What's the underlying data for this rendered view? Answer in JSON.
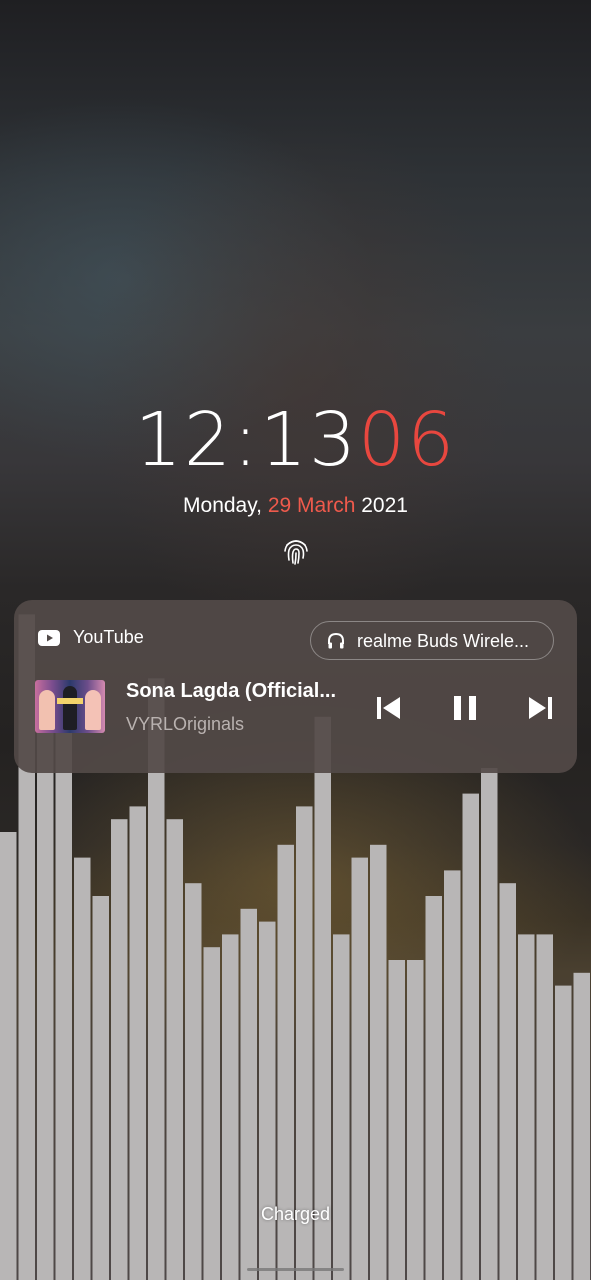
{
  "lockscreen": {
    "clock": {
      "hours_minutes": "12:13",
      "seconds": "06"
    },
    "date": {
      "weekday": "Monday, ",
      "day_month": "29 March",
      "year": " 2021"
    },
    "fingerprint_icon": "fingerprint-icon"
  },
  "media_card": {
    "app_name": "YouTube",
    "app_icon": "youtube-icon",
    "output_device": "realme Buds Wirele...",
    "output_icon": "headphones-icon",
    "track_title": "Sona Lagda (Official...",
    "artist": "VYRLOriginals",
    "controls": {
      "prev_icon": "skip-previous-icon",
      "pause_icon": "pause-icon",
      "next_icon": "skip-next-icon"
    }
  },
  "visualizer": {
    "bar_color": "#b8b6b6",
    "levels": [
      0.35,
      0.52,
      0.44,
      0.44,
      0.33,
      0.3,
      0.36,
      0.37,
      0.47,
      0.36,
      0.31,
      0.26,
      0.27,
      0.29,
      0.28,
      0.34,
      0.37,
      0.44,
      0.27,
      0.33,
      0.34,
      0.25,
      0.25,
      0.3,
      0.32,
      0.38,
      0.4,
      0.31,
      0.27,
      0.27,
      0.23,
      0.24
    ]
  },
  "status": {
    "battery_text": "Charged"
  },
  "colors": {
    "accent_red": "#e8473f",
    "card_bg": "#524a48"
  }
}
